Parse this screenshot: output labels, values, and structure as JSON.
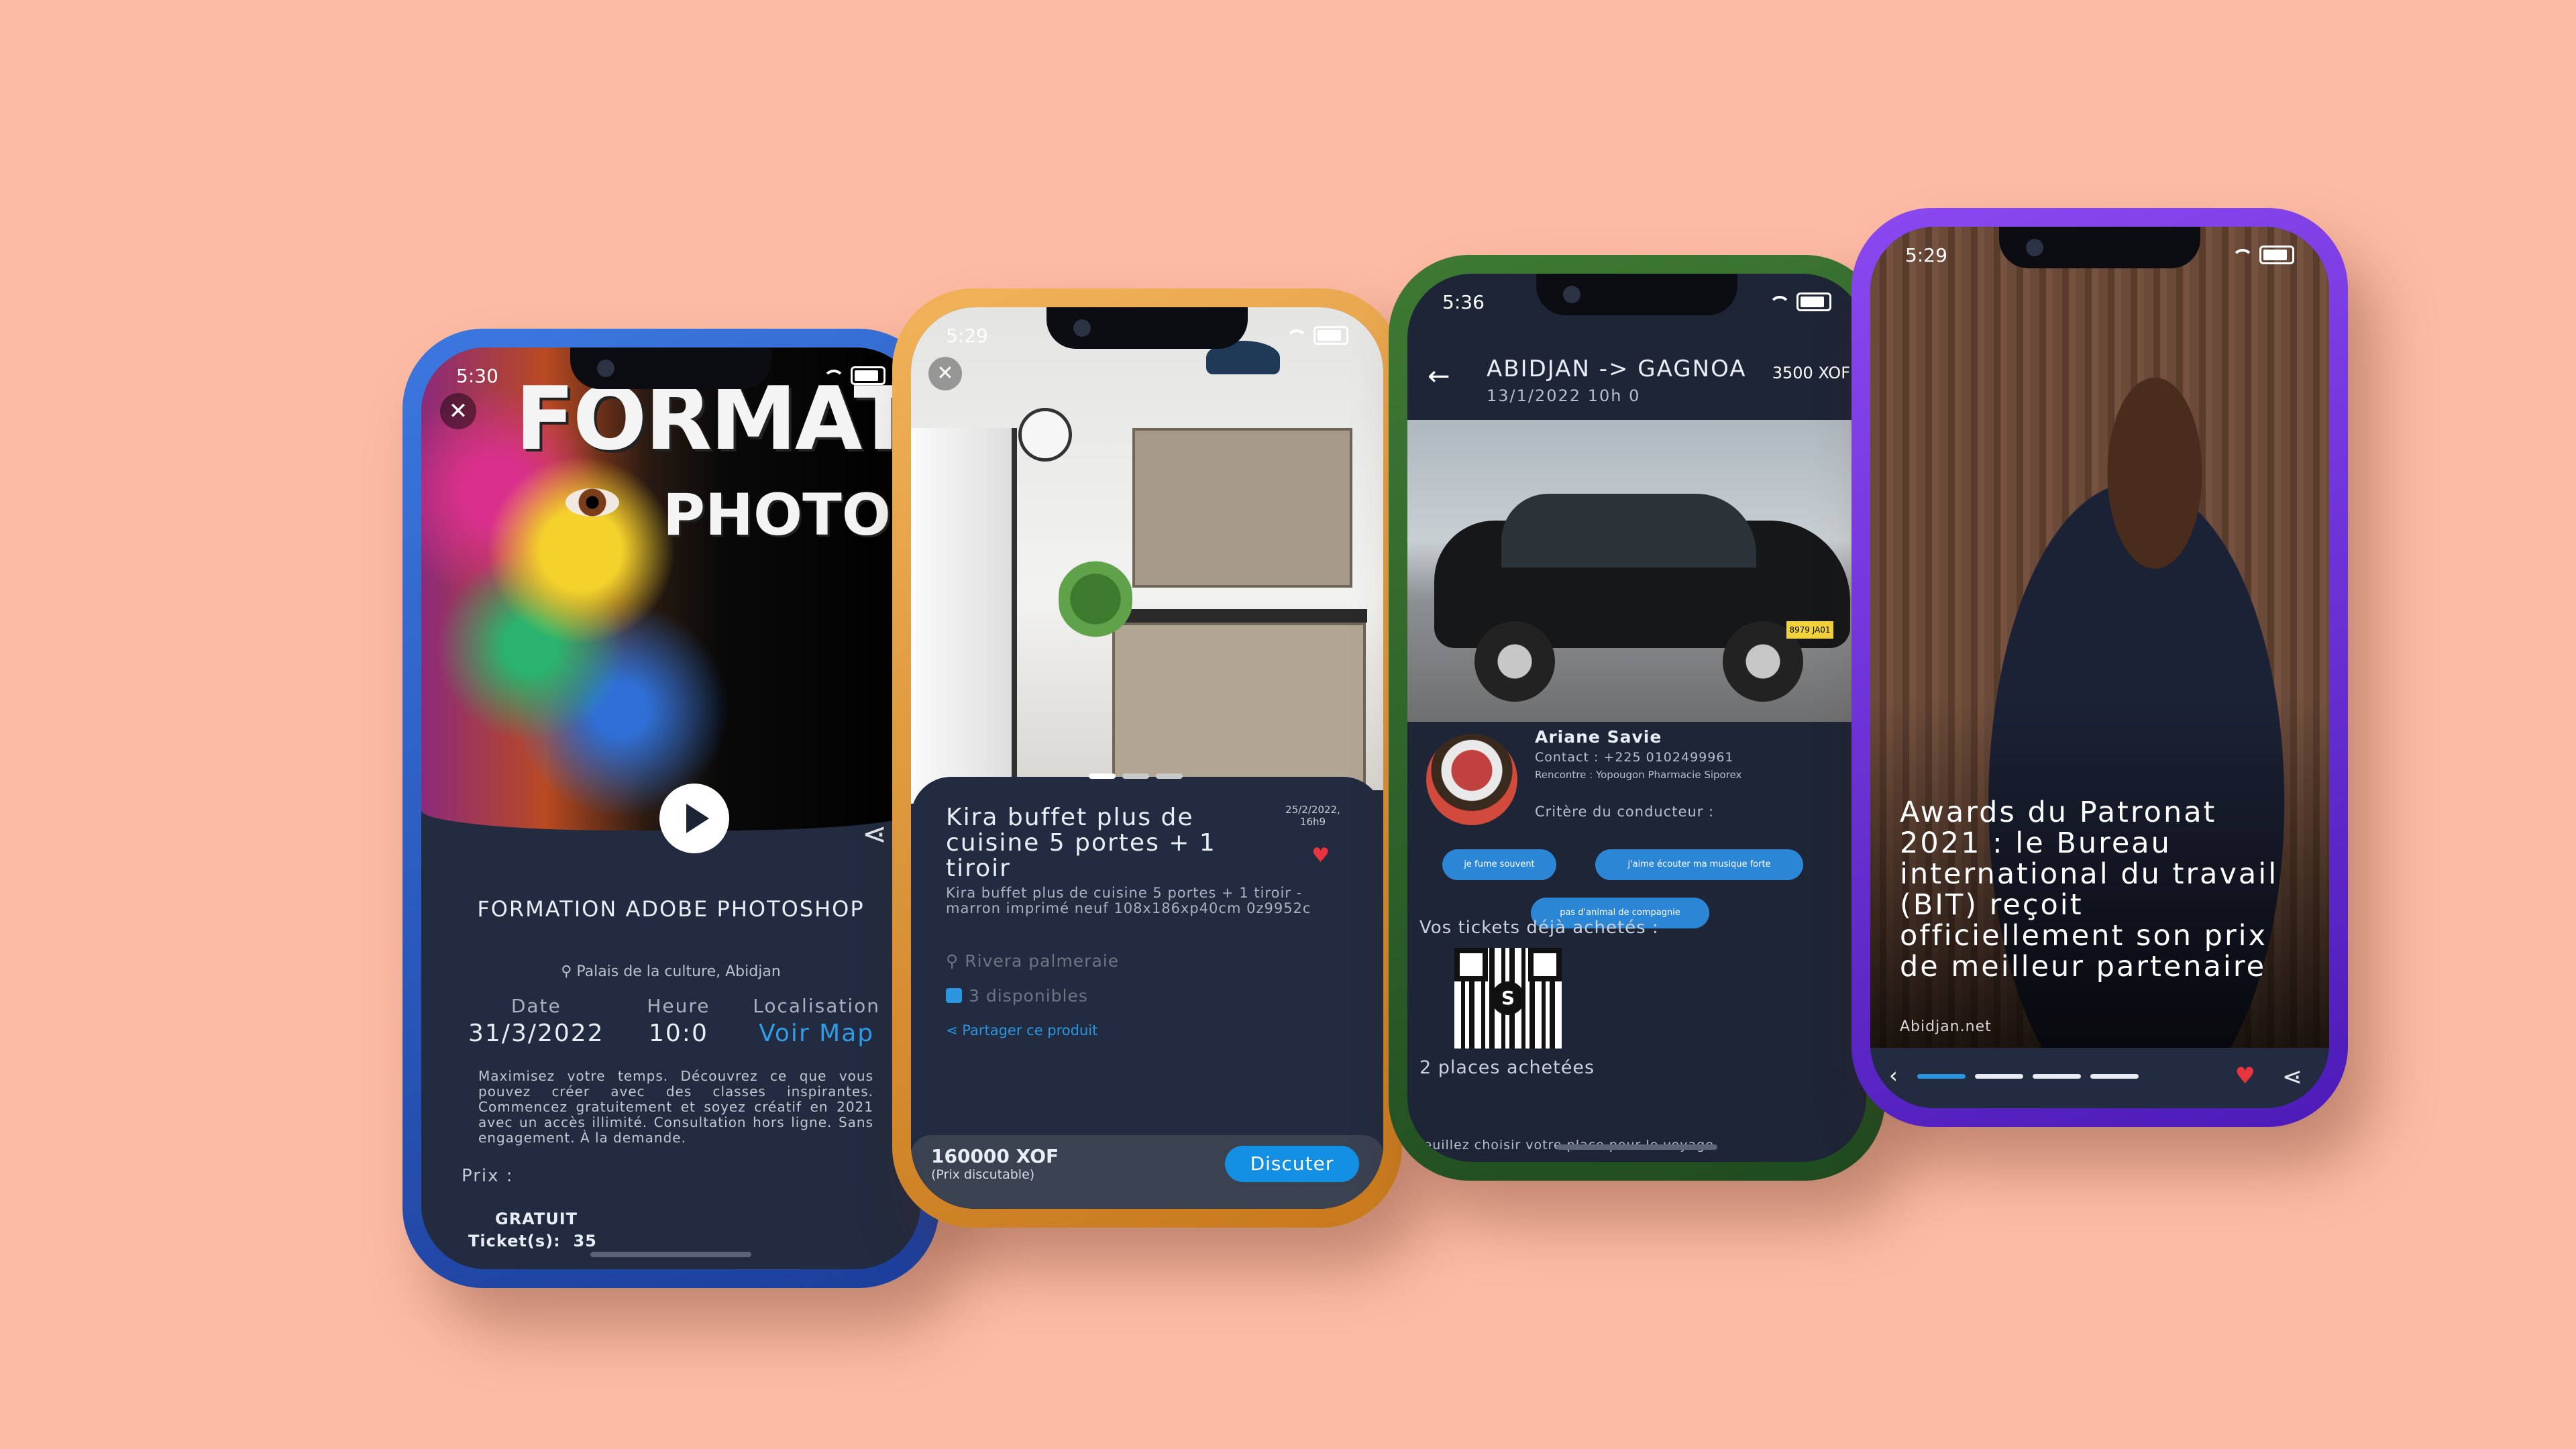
{
  "phone1": {
    "time": "5:30",
    "banner_line1": "FORMAT",
    "banner_line2": "PHOTOSH",
    "title": "FORMATION ADOBE PHOTOSHOP",
    "place": "Palais de la culture, Abidjan",
    "date_label": "Date",
    "date_value": "31/3/2022",
    "hour_label": "Heure",
    "hour_value": "10:0",
    "loc_label": "Localisation",
    "loc_link": "Voir Map",
    "description": "Maximisez votre temps. Découvrez ce que vous pouvez créer avec des classes inspirantes. Commencez gratuitement et soyez créatif en 2021 avec un accès illimité. Consultation hors ligne. Sans engagement. À la demande.",
    "price_label": "Prix :",
    "price_value": "GRATUIT",
    "tickets_label": "Ticket(s):",
    "tickets_value": "35"
  },
  "phone2": {
    "time": "5:29",
    "title": "Kira buffet plus de cuisine 5 portes + 1 tiroir",
    "date": "25/2/2022, 16h9",
    "subtitle": "Kira buffet plus de cuisine 5 portes + 1 tiroir - marron imprimé neuf 108x186xp40cm 0z9952c",
    "location": "Rivera palmeraie",
    "available": "3 disponibles",
    "share_label": "Partager ce produit",
    "price": "160000 XOF",
    "price_note": "(Prix discutable)",
    "cta": "Discuter"
  },
  "phone3": {
    "time": "5:36",
    "route": "ABIDJAN -> GAGNOA",
    "route_date": "13/1/2022   10h 0",
    "route_price": "3500 XOF",
    "plate": "8979 JA01",
    "driver_name": "Ariane Savie",
    "contact": "Contact : +225 0102499961",
    "meeting": "Rencontre : Yopougon Pharmacie Siporex",
    "criteria_label": "Critère du conducteur :",
    "chips": [
      "je fume souvent",
      "j'aime écouter ma musique forte",
      "pas d'animal de compagnie"
    ],
    "tickets_label": "Vos tickets déjà achetés :",
    "qr_letter": "S",
    "places": "2 places achetées",
    "footer_note": "Veuillez choisir votre place pour le voyage"
  },
  "phone4": {
    "time": "5:29",
    "headline": "Awards du Patronat 2021 : le Bureau international du travail (BIT) reçoit officiellement son prix de meilleur partenaire",
    "source": "Abidjan.net"
  }
}
